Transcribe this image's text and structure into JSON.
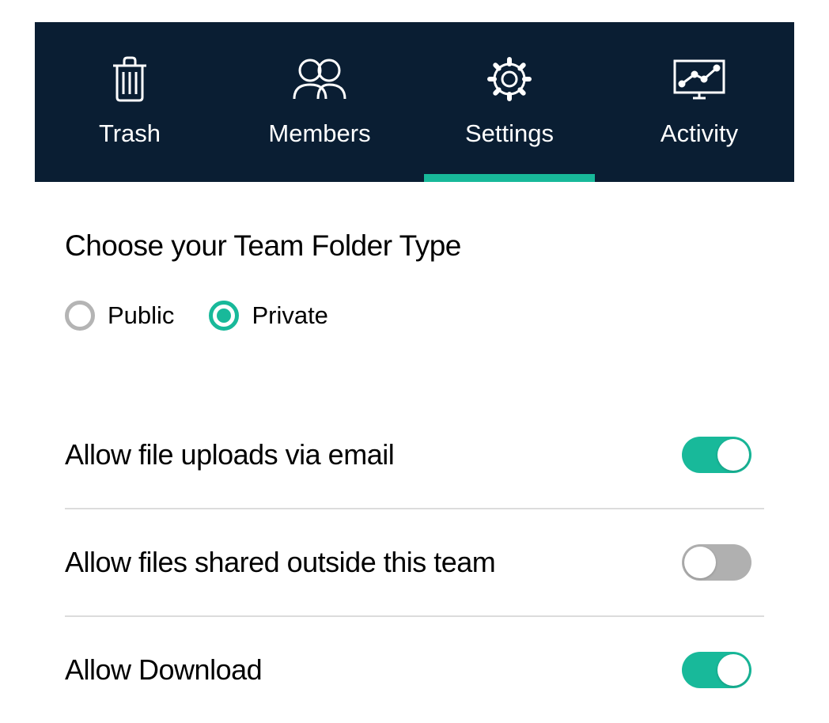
{
  "tabs": [
    {
      "label": "Trash",
      "icon": "trash",
      "active": false
    },
    {
      "label": "Members",
      "icon": "members",
      "active": false
    },
    {
      "label": "Settings",
      "icon": "settings",
      "active": true
    },
    {
      "label": "Activity",
      "icon": "activity",
      "active": false
    }
  ],
  "section_title": "Choose your Team Folder Type",
  "radio_options": {
    "public_label": "Public",
    "private_label": "Private",
    "selected": "private"
  },
  "settings": [
    {
      "label": "Allow file uploads via email",
      "on": true
    },
    {
      "label": "Allow files shared outside this team",
      "on": false
    },
    {
      "label": "Allow Download",
      "on": true
    }
  ]
}
